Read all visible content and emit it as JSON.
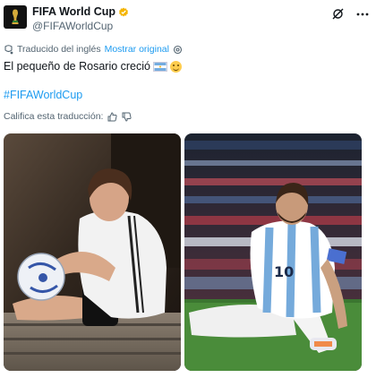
{
  "author": {
    "name": "FIFA World Cup",
    "handle": "@FIFAWorldCup",
    "verified_color": "#f4b400"
  },
  "actions": {
    "grok_icon": "grok-icon",
    "more_icon": "more-icon"
  },
  "translation": {
    "notice": "Traducido del inglés",
    "show_original": "Mostrar original",
    "settings_icon": "gear-icon"
  },
  "tweet": {
    "text": "El pequeño de Rosario creció",
    "emojis": [
      "argentina-flag",
      "smiling-face-with-tear"
    ],
    "hashtag": "#FIFAWorldCup"
  },
  "rating": {
    "prompt": "Califica esta traducción:",
    "up_icon": "thumbs-up-icon",
    "down_icon": "thumbs-down-icon"
  },
  "media": [
    {
      "name": "young-messi-photo",
      "description_icon": "photo"
    },
    {
      "name": "adult-messi-photo",
      "description_icon": "photo"
    }
  ],
  "colors": {
    "link": "#1d9bf0",
    "secondary_text": "#536471",
    "primary_text": "#0f1419",
    "argentina_blue": "#74acdf"
  }
}
